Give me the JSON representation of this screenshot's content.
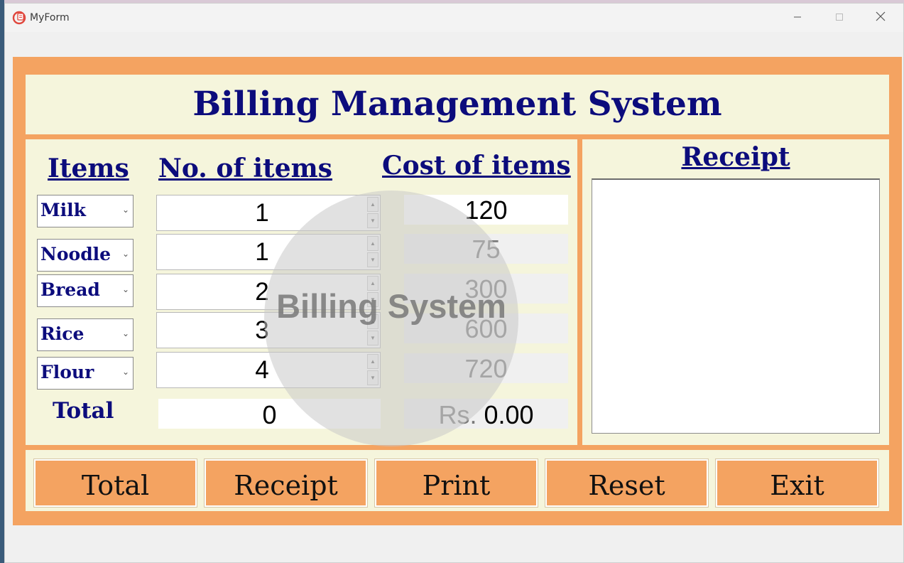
{
  "window": {
    "title": "MyForm"
  },
  "header": {
    "title": "Billing Management System"
  },
  "columns": {
    "items": "Items",
    "count": "No. of items",
    "cost": "Cost of items"
  },
  "rows": [
    {
      "item": "Milk",
      "count": "1",
      "cost": "120"
    },
    {
      "item": "Noodle",
      "count": "1",
      "cost": "75"
    },
    {
      "item": "Bread",
      "count": "2",
      "cost": "300"
    },
    {
      "item": "Rice",
      "count": "3",
      "cost": "600"
    },
    {
      "item": "Flour",
      "count": "4",
      "cost": "720"
    }
  ],
  "totals": {
    "label": "Total",
    "count": "0",
    "currency": "Rs.",
    "amount": "0.00"
  },
  "receipt": {
    "title": "Receipt",
    "text": ""
  },
  "buttons": {
    "total": "Total",
    "receipt": "Receipt",
    "print": "Print",
    "reset": "Reset",
    "exit": "Exit"
  },
  "watermark": {
    "text": "Billing System"
  },
  "colors": {
    "frame": "#f4a361",
    "panel": "#f5f5dc",
    "heading": "#0c0c7c"
  }
}
